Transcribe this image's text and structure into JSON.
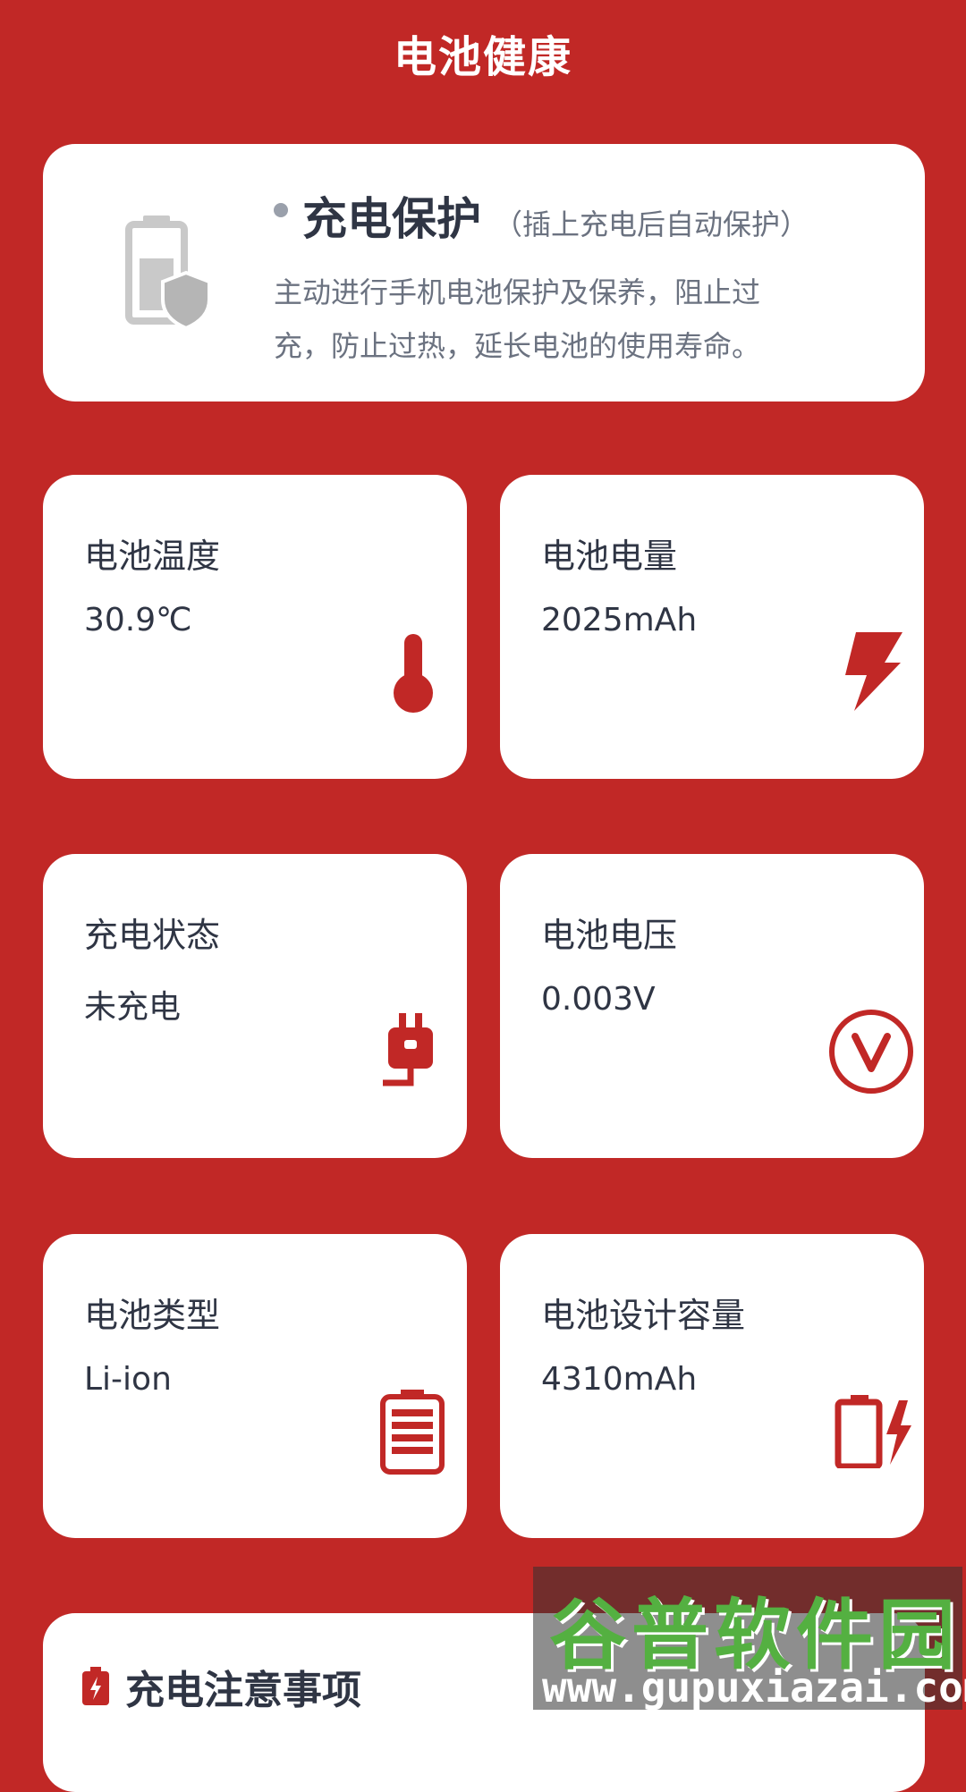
{
  "header": {
    "title": "电池健康"
  },
  "protection": {
    "title": "充电保护",
    "subtitle": "（插上充电后自动保护）",
    "desc_line1": "主动进行手机电池保护及保养，阻止过",
    "desc_line2": "充，防止过热，延长电池的使用寿命。",
    "icon": "battery-shield-icon"
  },
  "stats": [
    {
      "label": "电池温度",
      "value": "30.9℃",
      "icon": "thermometer-icon"
    },
    {
      "label": "电池电量",
      "value": "2025mAh",
      "icon": "lightning-icon"
    },
    {
      "label": "充电状态",
      "value": "未充电",
      "icon": "plug-icon"
    },
    {
      "label": "电池电压",
      "value": "0.003V",
      "icon": "voltage-icon"
    },
    {
      "label": "电池类型",
      "value": "Li-ion",
      "icon": "battery-full-icon"
    },
    {
      "label": "电池设计容量",
      "value": "4310mAh",
      "icon": "battery-charging-icon"
    }
  ],
  "notes": {
    "title": "充电注意事项",
    "icon": "charging-battery-small-icon"
  },
  "watermark": {
    "line1": "谷普软件园",
    "line2": "www.gupuxiazai.com"
  },
  "colors": {
    "background": "#c12826",
    "accent": "#c12826",
    "card": "#ffffff",
    "text": "#2f3544",
    "muted": "#6b7280"
  }
}
